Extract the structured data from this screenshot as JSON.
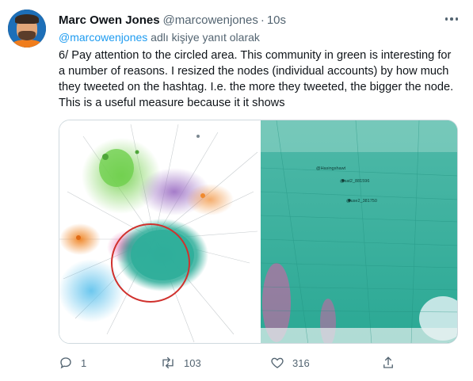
{
  "author": {
    "name": "Marc Owen Jones",
    "handle": "@marcowenjones",
    "time": "10s"
  },
  "reply_to": {
    "mention": "@marcowenjones",
    "suffix": " adlı kişiye yanıt olarak"
  },
  "text": "6/ Pay attention to the circled area. This community in green is interesting for a number of reasons. I resized the nodes (individual accounts) by how much they tweeted on the hashtag. I.e. the more they tweeted, the bigger the node. This is a useful measure because it  it shows",
  "media": {
    "left_image": "network-graph-with-red-circle",
    "right_image": "zoomed-green-community",
    "node_labels": [
      "@Hasingshawt",
      "@sat2_881596",
      "@use2_381750"
    ]
  },
  "actions": {
    "reply_count": "1",
    "retweet_count": "103",
    "like_count": "316"
  },
  "colors": {
    "text": "#0f1419",
    "muted": "#536471",
    "link": "#1d9bf0",
    "border": "#cfd9de",
    "community_green": "#31b3a0",
    "circle_red": "#d0312d"
  }
}
